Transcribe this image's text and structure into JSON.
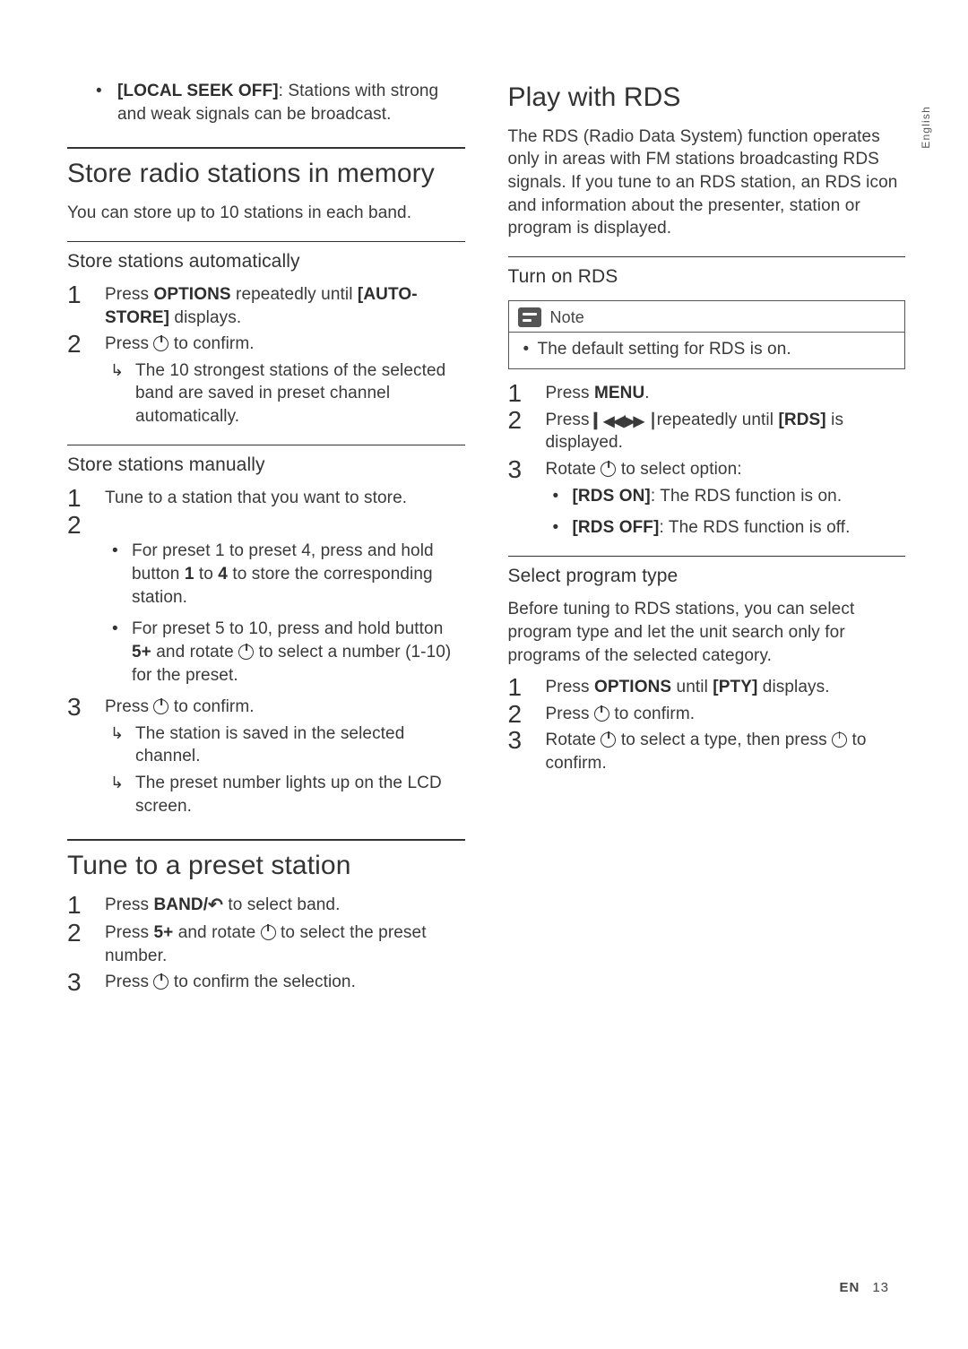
{
  "language_tab": "English",
  "footer": {
    "lang": "EN",
    "page": "13"
  },
  "left": {
    "intro_bullets": [
      {
        "label": "[LOCAL SEEK OFF]",
        "text": ": Stations with strong and weak signals can be broadcast."
      }
    ],
    "sec_store": {
      "title": "Store radio stations in memory",
      "desc": "You can store up to 10 stations in each band.",
      "auto": {
        "title": "Store stations automatically",
        "step1_a": "Press ",
        "step1_b": "OPTIONS",
        "step1_c": " repeatedly until ",
        "step1_d": "[AUTO-STORE]",
        "step1_e": " displays.",
        "step2_a": "Press ",
        "step2_b": " to confirm.",
        "step2_result": "The 10 strongest stations of the selected band are saved in preset channel automatically."
      },
      "manual": {
        "title": "Store stations manually",
        "step1": "Tune to a station that you want to store.",
        "step2_bullets": [
          {
            "a": "For preset 1 to preset 4, press and hold button ",
            "b": "1",
            "c": " to ",
            "d": "4",
            "e": " to store the corresponding station."
          },
          {
            "a": "For preset 5 to 10, press and hold button ",
            "b": "5+",
            "c": " and rotate ",
            "d": "",
            "e": " to select a number (1-10) for the preset."
          }
        ],
        "step3_a": "Press ",
        "step3_b": " to confirm.",
        "step3_results": [
          "The station is saved in the selected channel.",
          "The preset number lights up on the LCD screen."
        ]
      }
    },
    "sec_tune": {
      "title": "Tune to a preset station",
      "step1_a": "Press ",
      "step1_b": "BAND/",
      "step1_c": " to select band.",
      "step2_a": "Press ",
      "step2_b": "5+",
      "step2_c": " and rotate ",
      "step2_d": " to select the preset number.",
      "step3_a": "Press ",
      "step3_b": " to confirm the selection."
    }
  },
  "right": {
    "sec_rds": {
      "title": "Play with RDS",
      "desc": "The RDS (Radio Data System) function operates only in areas with FM stations broadcasting RDS signals. If you tune to an RDS station, an RDS icon and information about the presenter, station or program is displayed.",
      "turn_on": {
        "title": "Turn on RDS",
        "note_title": "Note",
        "note_body": "The default setting for RDS is on.",
        "step1_a": "Press ",
        "step1_b": "MENU",
        "step1_c": ".",
        "step2_a": "Press ",
        "step2_b": " repeatedly until ",
        "step2_c": "[RDS]",
        "step2_d": " is displayed.",
        "step3_a": "Rotate ",
        "step3_b": " to select option:",
        "step3_opts": [
          {
            "label": "[RDS ON]",
            "text": ": The RDS function is on."
          },
          {
            "label": "[RDS OFF]",
            "text": ": The RDS function is off."
          }
        ]
      },
      "pty": {
        "title": "Select program type",
        "desc": "Before tuning to RDS stations, you can select program type and let the unit search only for programs of the selected category.",
        "step1_a": "Press ",
        "step1_b": "OPTIONS",
        "step1_c": " until ",
        "step1_d": "[PTY]",
        "step1_e": " displays.",
        "step2_a": "Press ",
        "step2_b": " to confirm.",
        "step3_a": "Rotate ",
        "step3_b": " to select a type, then press ",
        "step3_c": " to confirm."
      }
    }
  }
}
